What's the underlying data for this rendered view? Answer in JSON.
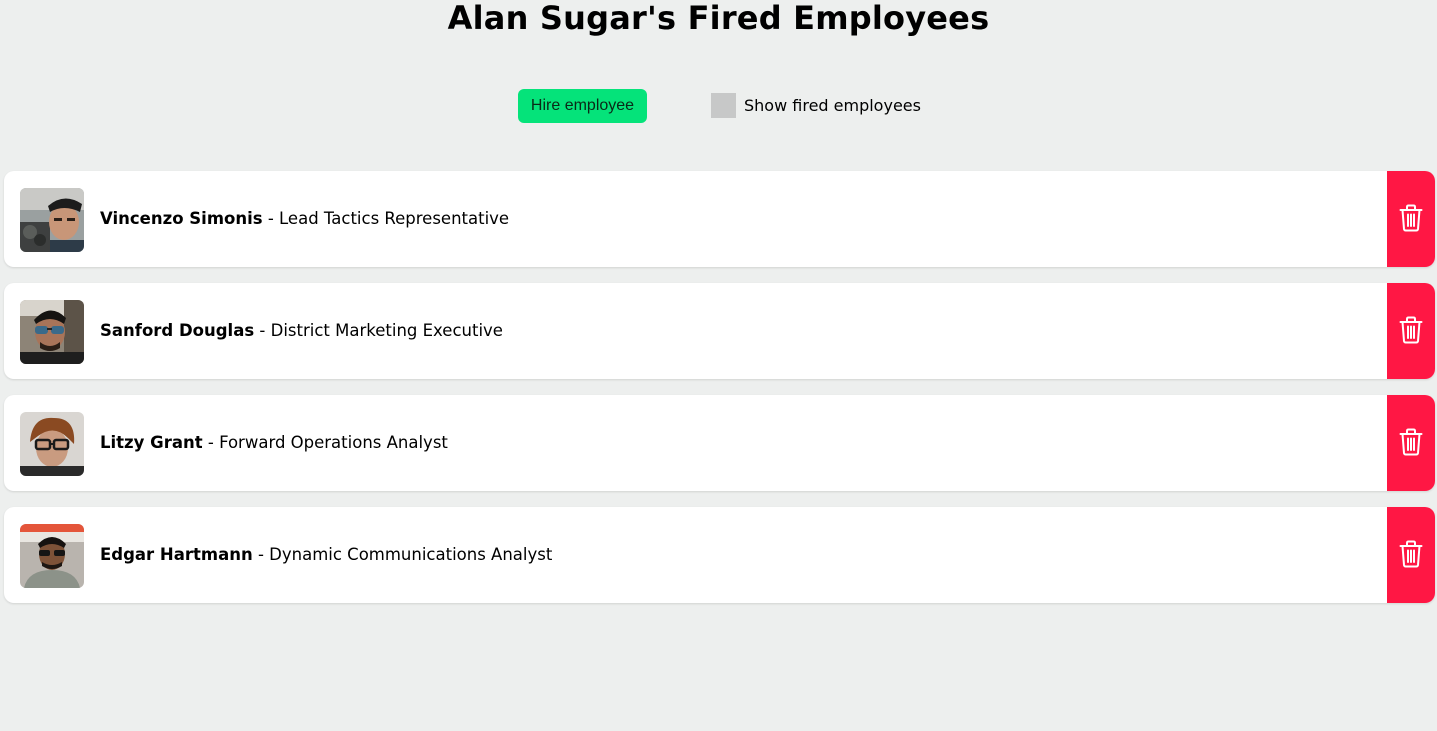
{
  "page": {
    "title": "Alan Sugar's Fired Employees"
  },
  "controls": {
    "hire_label": "Hire employee",
    "show_fired_label": "Show fired employees",
    "show_fired_checked": false
  },
  "colors": {
    "background": "#edefee",
    "hire_button": "#05e37a",
    "delete_button": "#ff1744",
    "checkbox_unchecked": "#c7c8c8"
  },
  "employees": [
    {
      "name": "Vincenzo Simonis",
      "separator": " - ",
      "title": "Lead Tactics Representative",
      "avatar": "person-photo",
      "action_icon": "trash-icon"
    },
    {
      "name": "Sanford Douglas",
      "separator": " - ",
      "title": "District Marketing Executive",
      "avatar": "person-photo",
      "action_icon": "trash-icon"
    },
    {
      "name": "Litzy Grant",
      "separator": " - ",
      "title": "Forward Operations Analyst",
      "avatar": "person-photo",
      "action_icon": "trash-icon"
    },
    {
      "name": "Edgar Hartmann",
      "separator": " - ",
      "title": "Dynamic Communications Analyst",
      "avatar": "person-photo",
      "action_icon": "trash-icon"
    }
  ]
}
